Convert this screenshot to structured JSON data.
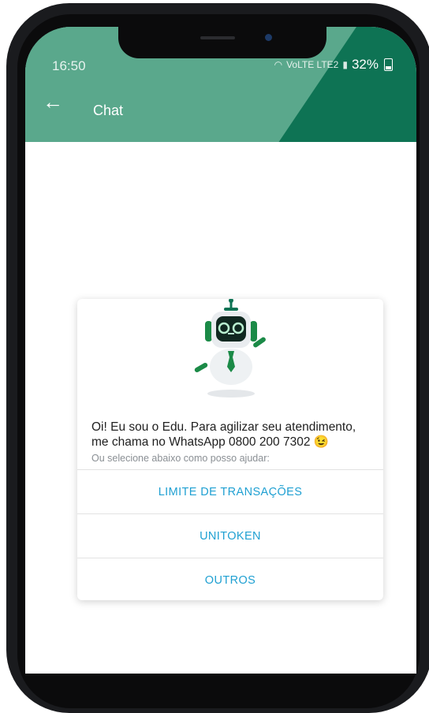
{
  "status_bar": {
    "time": "16:50",
    "network": "VoLTE LTE2",
    "battery": "32%"
  },
  "header": {
    "title": "Chat",
    "back_icon": "arrow-left-icon",
    "color": "#0e7354"
  },
  "bot": {
    "avatar_icon": "robot-icon",
    "message": "Oi! Eu sou o Edu. Para agilizar seu atendimento, me chama no WhatsApp 0800 200 7302 😉",
    "subtitle": "Ou selecione abaixo como posso ajudar:"
  },
  "options": [
    {
      "label": "LIMITE DE TRANSAÇÕES"
    },
    {
      "label": "UNITOKEN"
    },
    {
      "label": "OUTROS"
    }
  ],
  "colors": {
    "accent": "#0e7354",
    "link": "#1fa0d2"
  }
}
